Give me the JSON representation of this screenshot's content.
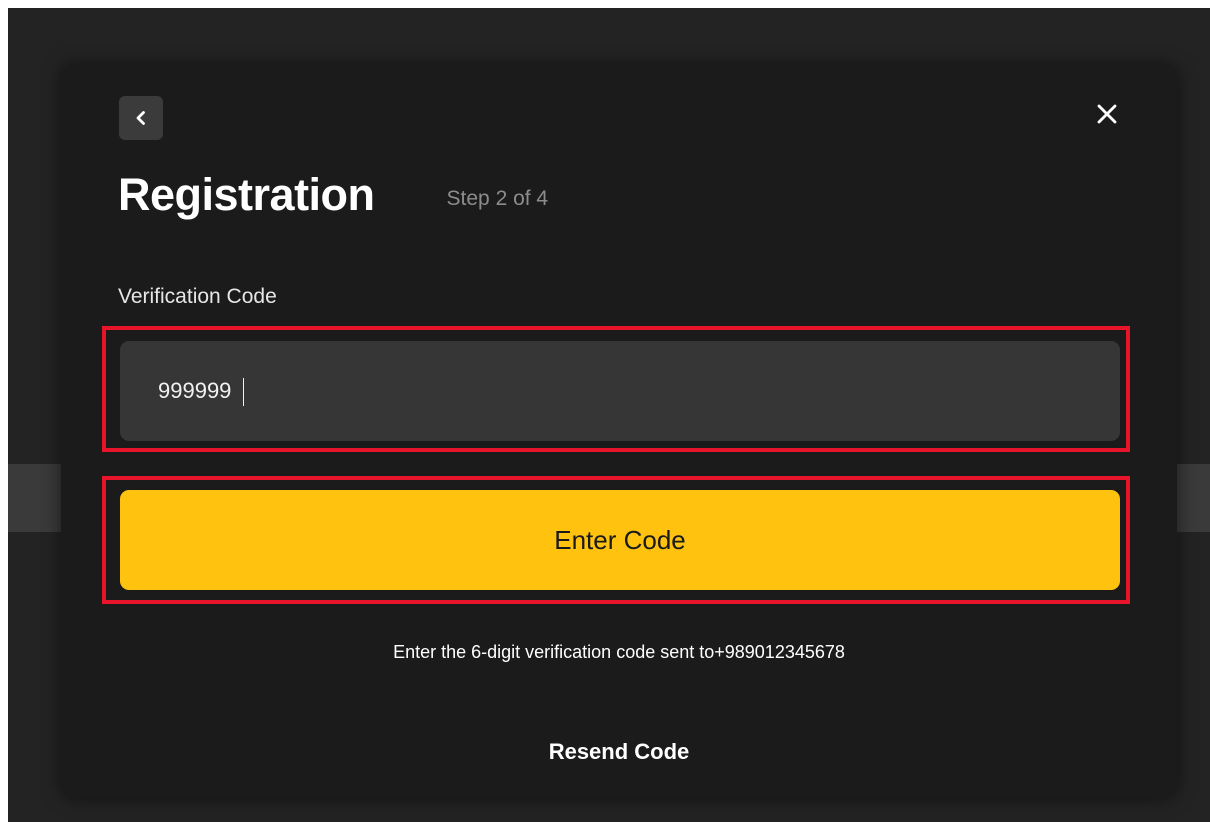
{
  "colors": {
    "backdrop": "#232323",
    "modal": "#1b1b1b",
    "input_bg": "#363636",
    "accent": "#ffc20e",
    "highlight": "#e8142a",
    "muted_text": "#8c8c8c"
  },
  "icons": {
    "back": "chevron-left-icon",
    "close": "close-icon"
  },
  "modal": {
    "title": "Registration",
    "step": "Step 2 of 4",
    "field_label": "Verification Code",
    "code_value": "999999",
    "submit_label": "Enter Code",
    "helper_text": "Enter the 6-digit verification code sent to+989012345678",
    "resend_label": "Resend Code"
  }
}
